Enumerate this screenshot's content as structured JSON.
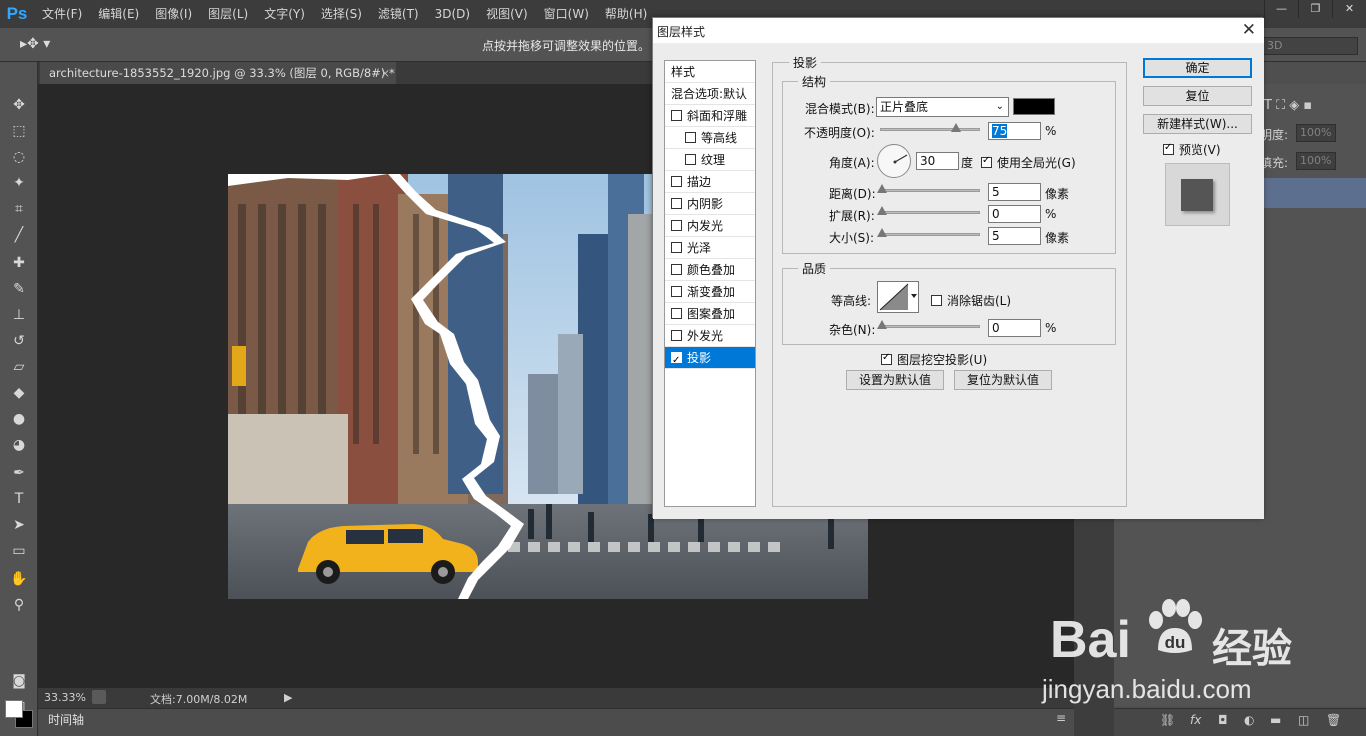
{
  "app": {
    "logo": "Ps"
  },
  "menu": [
    "文件(F)",
    "编辑(E)",
    "图像(I)",
    "图层(L)",
    "文字(Y)",
    "选择(S)",
    "滤镜(T)",
    "3D(D)",
    "视图(V)",
    "窗口(W)",
    "帮助(H)"
  ],
  "window_controls": [
    "—",
    "❐",
    "✕"
  ],
  "options_bar": {
    "tool_glyph": "▸✥ ▾",
    "hint": "点按并拖移可调整效果的位置。",
    "mode_3d": "3D"
  },
  "document": {
    "tab_title": "architecture-1853552_1920.jpg @ 33.3% (图层 0, RGB/8#) *",
    "tab_close": "×"
  },
  "status": {
    "zoom": "33.33%",
    "doc_info": "文档:7.00M/8.02M",
    "arrow": "▶"
  },
  "timeline": {
    "label": "时间轴",
    "menu_glyph": "≡"
  },
  "right_panel": {
    "opacity_label": "明度:",
    "opacity_value": "100%",
    "fill_label": "填充:",
    "fill_value": "100%",
    "footer_icons": [
      "⛓",
      "fx",
      "◘",
      "◐",
      "▬",
      "◫",
      "🗑"
    ]
  },
  "watermark": {
    "brand": "Bai",
    "brand_cn": "经验",
    "url": "jingyan.baidu.com"
  },
  "dialog": {
    "title": "图层样式",
    "close": "✕",
    "style_list": {
      "header": "样式",
      "blend_header": "混合选项:默认",
      "items": [
        {
          "label": "斜面和浮雕",
          "checked": false,
          "indent": false
        },
        {
          "label": "等高线",
          "checked": false,
          "indent": true
        },
        {
          "label": "纹理",
          "checked": false,
          "indent": true
        },
        {
          "label": "描边",
          "checked": false,
          "indent": false
        },
        {
          "label": "内阴影",
          "checked": false,
          "indent": false
        },
        {
          "label": "内发光",
          "checked": false,
          "indent": false
        },
        {
          "label": "光泽",
          "checked": false,
          "indent": false
        },
        {
          "label": "颜色叠加",
          "checked": false,
          "indent": false
        },
        {
          "label": "渐变叠加",
          "checked": false,
          "indent": false
        },
        {
          "label": "图案叠加",
          "checked": false,
          "indent": false
        },
        {
          "label": "外发光",
          "checked": false,
          "indent": false
        },
        {
          "label": "投影",
          "checked": true,
          "indent": false,
          "selected": true
        }
      ]
    },
    "section_title": "投影",
    "structure": {
      "title": "结构",
      "blend_mode_label": "混合模式(B):",
      "blend_mode_value": "正片叠底",
      "blend_color": "#000000",
      "opacity_label": "不透明度(O):",
      "opacity_value": "75",
      "opacity_fraction": 0.75,
      "percent": "%",
      "angle_label": "角度(A):",
      "angle_value": "30",
      "angle_unit": "度",
      "global_light_label": "使用全局光(G)",
      "global_light_checked": true,
      "distance_label": "距离(D):",
      "distance_value": "5",
      "distance_unit": "像素",
      "spread_label": "扩展(R):",
      "spread_value": "0",
      "size_label": "大小(S):",
      "size_value": "5",
      "size_unit": "像素"
    },
    "quality": {
      "title": "品质",
      "contour_label": "等高线:",
      "antialias_label": "消除锯齿(L)",
      "antialias_checked": false,
      "noise_label": "杂色(N):",
      "noise_value": "0"
    },
    "knockout_label": "图层挖空投影(U)",
    "knockout_checked": true,
    "set_default": "设置为默认值",
    "reset_default": "复位为默认值",
    "ok": "确定",
    "reset": "复位",
    "new_style": "新建样式(W)...",
    "preview_label": "预览(V)",
    "preview_checked": true
  }
}
